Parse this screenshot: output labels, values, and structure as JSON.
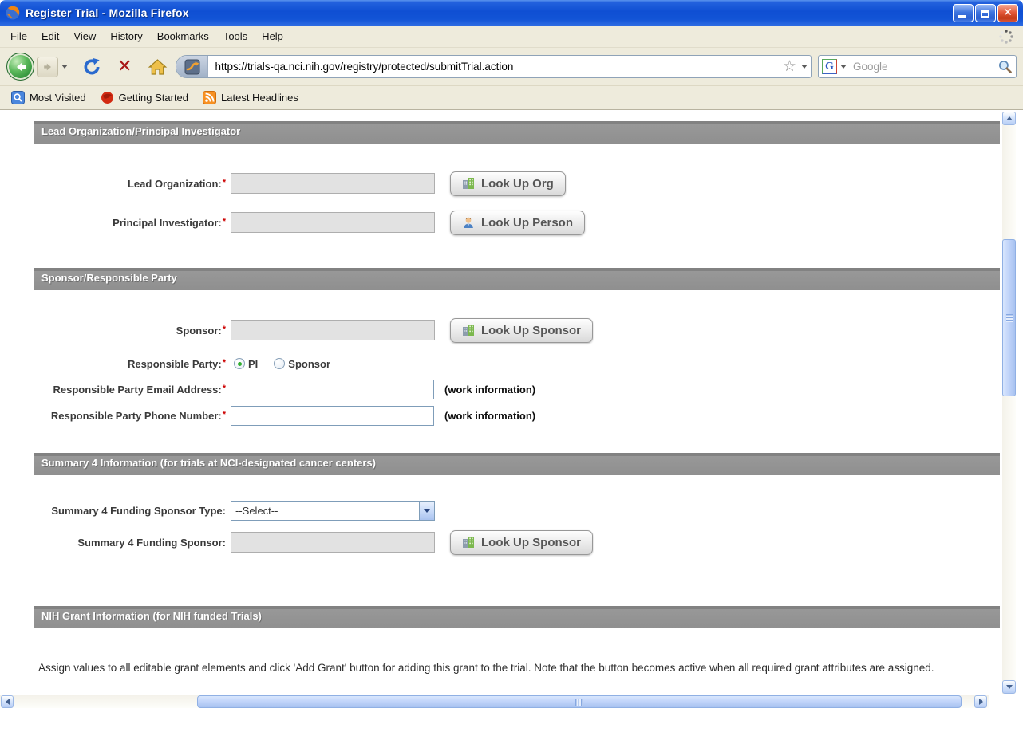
{
  "window": {
    "title": "Register Trial - Mozilla Firefox"
  },
  "menubar": {
    "items": [
      {
        "pre": "",
        "key": "F",
        "post": "ile"
      },
      {
        "pre": "",
        "key": "E",
        "post": "dit"
      },
      {
        "pre": "",
        "key": "V",
        "post": "iew"
      },
      {
        "pre": "Hi",
        "key": "s",
        "post": "tory"
      },
      {
        "pre": "",
        "key": "B",
        "post": "ookmarks"
      },
      {
        "pre": "",
        "key": "T",
        "post": "ools"
      },
      {
        "pre": "",
        "key": "H",
        "post": "elp"
      }
    ]
  },
  "navbar": {
    "url": "https://trials-qa.nci.nih.gov/registry/protected/submitTrial.action",
    "search": {
      "placeholder": "Google"
    }
  },
  "bookmarks_toolbar": {
    "items": [
      "Most Visited",
      "Getting Started",
      "Latest Headlines"
    ]
  },
  "icons": {
    "close_glyph": "✕",
    "stop_glyph": "✕",
    "star_glyph": "☆",
    "google_g": "G"
  },
  "colors": {
    "titlebar_blue": "#1254d6",
    "section_header_gray": "#959595",
    "required_red": "#cc0000",
    "enabled_input_border": "#7f9db9",
    "disabled_input_fill": "#e2e2e2",
    "scrollbar_blue": "#c2d5fa"
  },
  "form": {
    "required_marker": "*",
    "sections": [
      {
        "title": "Lead Organization/Principal Investigator"
      },
      {
        "title": "Sponsor/Responsible Party"
      },
      {
        "title": "Summary 4 Information (for trials at NCI-designated cancer centers)"
      },
      {
        "title": "NIH Grant Information (for NIH funded Trials)"
      }
    ],
    "lead_organization": {
      "label": "Lead Organization:",
      "value": "",
      "button": "Look Up Org"
    },
    "principal_investigator": {
      "label": "Principal Investigator:",
      "value": "",
      "button": "Look Up Person"
    },
    "sponsor": {
      "label": "Sponsor:",
      "value": "",
      "button": "Look Up Sponsor"
    },
    "responsible_party": {
      "label": "Responsible Party:",
      "options": [
        {
          "label": "PI",
          "selected": true
        },
        {
          "label": "Sponsor",
          "selected": false
        }
      ]
    },
    "responsible_party_email": {
      "label": "Responsible Party Email Address:",
      "value": "",
      "note": "(work information)"
    },
    "responsible_party_phone": {
      "label": "Responsible Party Phone Number:",
      "value": "",
      "note": "(work information)"
    },
    "summary4_sponsor_type": {
      "label": "Summary 4 Funding Sponsor Type:",
      "value": "--Select--"
    },
    "summary4_sponsor": {
      "label": "Summary 4 Funding Sponsor:",
      "value": "",
      "button": "Look Up Sponsor"
    },
    "nih_grant_instructions": "Assign values to all editable grant elements and click 'Add Grant' button for adding this grant to the trial. Note that the button becomes active when all required grant attributes are assigned."
  }
}
